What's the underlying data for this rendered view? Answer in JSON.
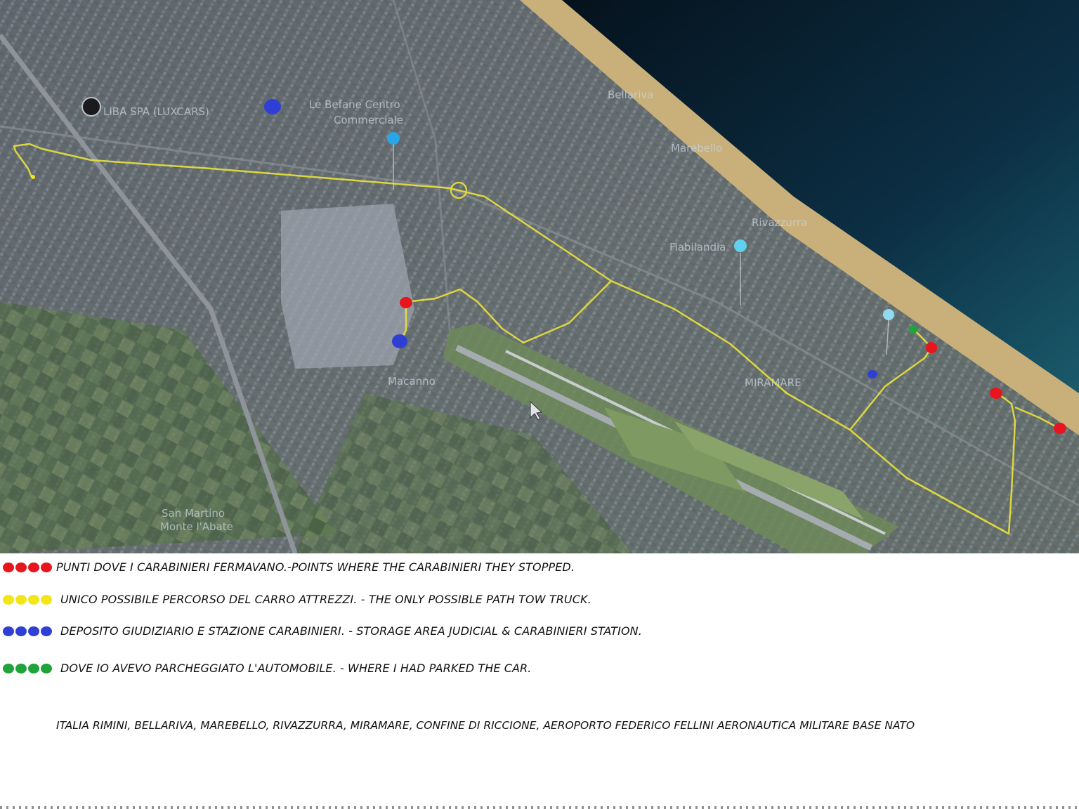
{
  "map": {
    "place_labels": [
      {
        "id": "lux",
        "text": "LIBA SPA (LUXCARS)"
      },
      {
        "id": "befane1",
        "text": "Le Befane Centro"
      },
      {
        "id": "befane2",
        "text": "Commerciale"
      },
      {
        "id": "bellariva",
        "text": "Bellariva"
      },
      {
        "id": "marebello",
        "text": "Marebello"
      },
      {
        "id": "rivazzurra",
        "text": "Rivazzurra"
      },
      {
        "id": "fiabilandia",
        "text": "Fiabilandia"
      },
      {
        "id": "miramare",
        "text": "MIRAMARE"
      },
      {
        "id": "macanno",
        "text": "Macanno"
      },
      {
        "id": "sanmartino1",
        "text": "San Martino"
      },
      {
        "id": "sanmartino2",
        "text": "Monte l'Abate"
      }
    ],
    "colors": {
      "route": "#e9e23a",
      "stop": "#e8141e",
      "deposit": "#2f3fd6",
      "parked": "#1fa33a",
      "sea": "#0c2f44",
      "beach": "#c9b07a"
    }
  },
  "legend": {
    "items": [
      {
        "color": "#e8141e",
        "text": "PUNTI DOVE I CARABINIERI FERMAVANO.-POINTS WHERE THE CARABINIERI THEY STOPPED."
      },
      {
        "color": "#f2e61a",
        "text": "UNICO POSSIBILE PERCORSO DEL CARRO ATTREZZI. - THE ONLY POSSIBLE  PATH TOW TRUCK."
      },
      {
        "color": "#2f3fd6",
        "text": "DEPOSITO GIUDIZIARIO E STAZIONE CARABINIERI. - STORAGE AREA JUDICIAL & CARABINIERI STATION."
      },
      {
        "color": "#1fa33a",
        "text": "DOVE IO AVEVO PARCHEGGIATO L'AUTOMOBILE.  -   WHERE I HAD PARKED THE CAR."
      }
    ],
    "footer": "ITALIA RIMINI, BELLARIVA, MAREBELLO, RIVAZZURRA, MIRAMARE, CONFINE DI RICCIONE, AEROPORTO FEDERICO FELLINI AERONAUTICA MILITARE BASE NATO"
  }
}
